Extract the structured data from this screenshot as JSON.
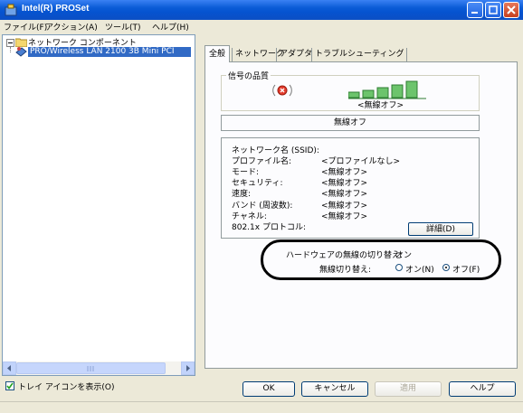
{
  "window": {
    "title": "Intel(R) PROSet"
  },
  "menu": {
    "items": [
      "ファイル(F)",
      "アクション(A)",
      "ツール(T)",
      "ヘルプ(H)"
    ]
  },
  "tree": {
    "root_label": "ネットワーク コンポーネント",
    "selected_item": "PRO/Wireless LAN 2100 3B Mini PCI"
  },
  "tray": {
    "label": "トレイ アイコンを表示(O)",
    "checked": true
  },
  "tabs": [
    "全般",
    "ネットワーク",
    "アダプタ",
    "トラブルシューティング"
  ],
  "signal": {
    "group_title": "信号の品質",
    "label": "<無線オフ>"
  },
  "status_text": "無線オフ",
  "info": {
    "rows": [
      {
        "label": "ネットワーク名 (SSID):",
        "value": ""
      },
      {
        "label": "プロファイル名:",
        "value": "<プロファイルなし>"
      },
      {
        "label": "モード:",
        "value": "<無線オフ>"
      },
      {
        "label": "セキュリティ:",
        "value": "<無線オフ>"
      },
      {
        "label": "速度:",
        "value": "<無線オフ>"
      },
      {
        "label": "バンド (周波数):",
        "value": "<無線オフ>"
      },
      {
        "label": "チャネル:",
        "value": "<無線オフ>"
      },
      {
        "label": "802.1x プロトコル:",
        "value": ""
      }
    ],
    "details_button": "詳細(D)"
  },
  "radio_switch": {
    "hw_label": "ハードウェアの無線の切り替え:",
    "hw_value": "オン",
    "sw_label": "無線切り替え:",
    "on_label": "オン(N)",
    "off_label": "オフ(F)",
    "selected": "off"
  },
  "buttons": {
    "ok": "OK",
    "cancel": "キャンセル",
    "apply": "適用",
    "help": "ヘルプ"
  },
  "colors": {
    "titlebar": "#0a5bd6",
    "selection": "#316ac5",
    "window_bg": "#ece9d8"
  }
}
